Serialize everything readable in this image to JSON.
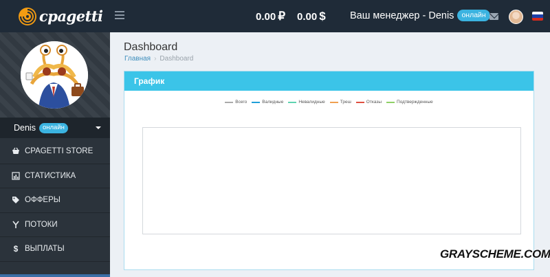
{
  "header": {
    "logo_text": "cpagetti",
    "balance_rub": "0.00",
    "currency_rub": "₽",
    "balance_usd": "0.00",
    "currency_usd": "$",
    "manager_label": "Ваш менеджер - Denis",
    "manager_status": "онлайн",
    "icons": [
      "menu-icon",
      "mail-icon",
      "user-avatar",
      "flag-russia-icon"
    ]
  },
  "sidebar": {
    "user_name": "Denis",
    "user_status": "онлайн",
    "items": [
      {
        "label": "CPAGETTI STORE",
        "icon": "basket-icon"
      },
      {
        "label": "СТАТИСТИКА",
        "icon": "bar-chart-icon"
      },
      {
        "label": "ОФФЕРЫ",
        "icon": "tag-icon"
      },
      {
        "label": "ПОТОКИ",
        "icon": "flow-icon"
      },
      {
        "label": "ВЫПЛАТЫ",
        "icon": "dollar-icon"
      }
    ]
  },
  "main": {
    "title": "Dashboard",
    "breadcrumb_home": "Главная",
    "breadcrumb_current": "Dashboard",
    "panel_title": "График"
  },
  "chart_data": {
    "type": "line",
    "title": "",
    "series": [
      {
        "name": "Всего",
        "color": "#aaaaaa",
        "values": []
      },
      {
        "name": "Валидные",
        "color": "#1f9fd8",
        "values": []
      },
      {
        "name": "Невалидные",
        "color": "#5fd3b0",
        "values": []
      },
      {
        "name": "Треш",
        "color": "#f0a050",
        "values": []
      },
      {
        "name": "Отказы",
        "color": "#e05040",
        "values": []
      },
      {
        "name": "Подтвержденные",
        "color": "#8fd066",
        "values": []
      }
    ]
  },
  "watermark": "GRAYSCHEME.COM"
}
